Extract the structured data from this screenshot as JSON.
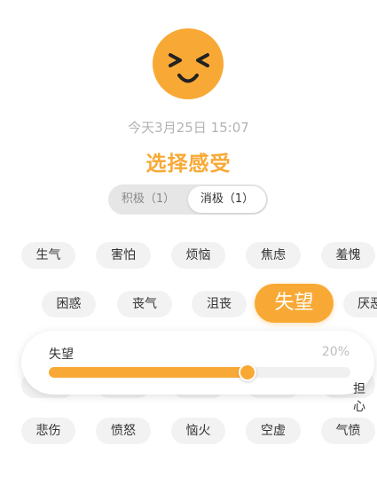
{
  "mood_icon": "laughing-face-icon",
  "timestamp": "今天3月25日 15:07",
  "title": "选择感受",
  "tabs": {
    "positive": "积极（1）",
    "negative": "消极（1）",
    "selected": "negative"
  },
  "feelings": [
    [
      "生气",
      "害怕",
      "烦恼",
      "焦虑",
      "羞愧"
    ],
    [
      "困惑",
      "丧气",
      "沮丧",
      "失望",
      "厌恶"
    ],
    [
      "悲伤",
      "愤怒",
      "恼火",
      "空虚",
      "气愤"
    ]
  ],
  "selected_feeling": "失望",
  "intensity": {
    "label": "失望",
    "percent_text": "20%",
    "slider_fraction": 0.66
  },
  "hidden_row_peek": "担心",
  "colors": {
    "accent": "#F8A935",
    "chip_bg": "#f2f2f2",
    "muted_text": "#b3b3b3"
  }
}
